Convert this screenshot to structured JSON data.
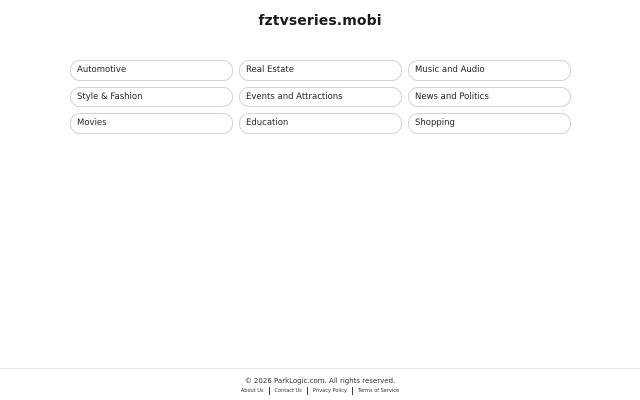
{
  "header": {
    "site_title": "fztvseries.mobi"
  },
  "categories": [
    "Automotive",
    "Real Estate",
    "Music and Audio",
    "Style & Fashion",
    "Events and Attractions",
    "News and Politics",
    "Movies",
    "Education",
    "Shopping"
  ],
  "footer": {
    "copyright": "© 2026 ParkLogic.com. All rights reserved.",
    "links": [
      "About Us",
      "Contact Us",
      "Privacy Policy",
      "Terms of Service"
    ]
  }
}
